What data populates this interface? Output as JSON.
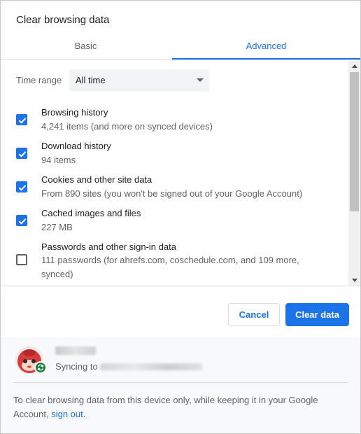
{
  "dialog": {
    "title": "Clear browsing data"
  },
  "tabs": [
    {
      "label": "Basic",
      "active": false
    },
    {
      "label": "Advanced",
      "active": true
    }
  ],
  "time_range": {
    "label": "Time range",
    "value": "All time"
  },
  "options": [
    {
      "title": "Browsing history",
      "subtitle": "4,241 items (and more on synced devices)",
      "checked": true
    },
    {
      "title": "Download history",
      "subtitle": "94 items",
      "checked": true
    },
    {
      "title": "Cookies and other site data",
      "subtitle": "From 890 sites (you won't be signed out of your Google Account)",
      "checked": true
    },
    {
      "title": "Cached images and files",
      "subtitle": "227 MB",
      "checked": true
    },
    {
      "title": "Passwords and other sign-in data",
      "subtitle": "111 passwords (for ahrefs.com, coschedule.com, and 109 more, synced)",
      "checked": false
    }
  ],
  "buttons": {
    "cancel": "Cancel",
    "clear": "Clear data"
  },
  "account": {
    "syncing_label": "Syncing to"
  },
  "footer": {
    "text_before_link": "To clear browsing data from this device only, while keeping it in your Google Account, ",
    "link": "sign out",
    "text_after_link": "."
  },
  "colors": {
    "accent": "#1a73e8",
    "sync_badge": "#188038",
    "text_primary": "#202124",
    "text_secondary": "#5f6368"
  }
}
